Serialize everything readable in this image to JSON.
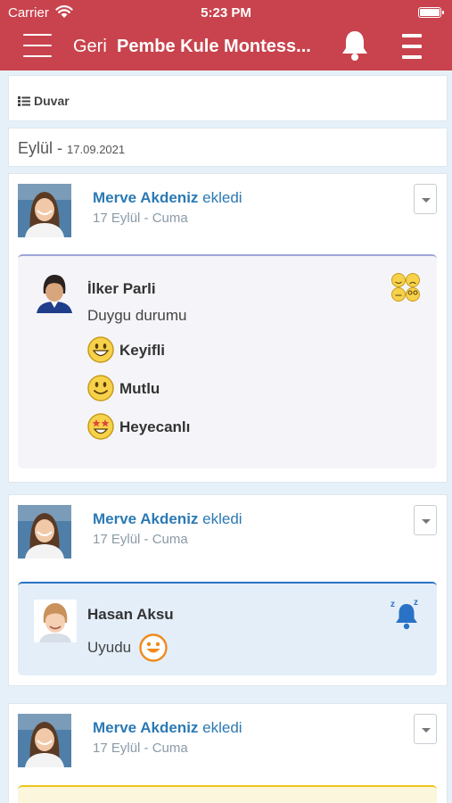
{
  "status_bar": {
    "carrier": "Carrier",
    "time": "5:23 PM"
  },
  "header": {
    "back_label": "Geri",
    "title": "Pembe Kule Montess..."
  },
  "wall": {
    "tab_label": "Duvar"
  },
  "date_group": {
    "month": "Eylül",
    "separator": "-",
    "date": "17.09.2021"
  },
  "posts": [
    {
      "author": "Merve Akdeniz",
      "action": "ekledi",
      "date": "17 Eylül - Cuma",
      "card": {
        "type": "mood",
        "child_name": "İlker Parli",
        "subtitle": "Duygu durumu",
        "moods": [
          {
            "icon": "grinning-face-icon",
            "label": "Keyifli"
          },
          {
            "icon": "smiling-face-icon",
            "label": "Mutlu"
          },
          {
            "icon": "star-struck-face-icon",
            "label": "Heyecanlı"
          }
        ],
        "corner_icon": "mood-faces-icon"
      }
    },
    {
      "author": "Merve Akdeniz",
      "action": "ekledi",
      "date": "17 Eylül - Cuma",
      "card": {
        "type": "sleep",
        "child_name": "Hasan Aksu",
        "text": "Uyudu",
        "text_icon": "smiley-icon",
        "corner_icon": "sleep-bell-icon"
      }
    },
    {
      "author": "Merve Akdeniz",
      "action": "ekledi",
      "date": "17 Eylül - Cuma"
    }
  ],
  "colors": {
    "header": "#c8434d",
    "link": "#2b79b4",
    "muted": "#8a9aa6",
    "mood_border": "#9ea5d8",
    "sleep_border": "#2a72c5",
    "sleep_bg": "#e4eef9",
    "yellow_border": "#f0c419"
  }
}
